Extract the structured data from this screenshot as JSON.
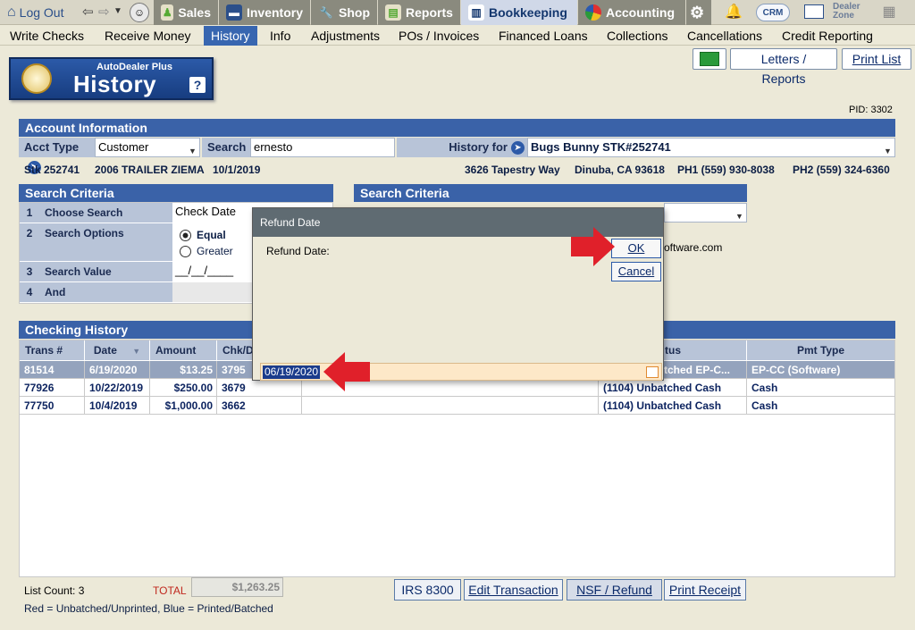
{
  "topnav": {
    "logout": "Log Out",
    "tabs": [
      {
        "label": "Sales",
        "icon": "salesperson-icon"
      },
      {
        "label": "Inventory",
        "icon": "car-icon"
      },
      {
        "label": "Shop",
        "icon": "wrench-icon"
      },
      {
        "label": "Reports",
        "icon": "report-icon"
      },
      {
        "label": "Bookkeeping",
        "icon": "book-icon"
      },
      {
        "label": "Accounting",
        "icon": "pie-chart-icon"
      }
    ],
    "crm_label": "CRM",
    "dealer_zone_label": "Dealer Zone"
  },
  "subnav": [
    "Write Checks",
    "Receive Money",
    "History",
    "Info",
    "Adjustments",
    "POs / Invoices",
    "Financed Loans",
    "Collections",
    "Cancellations",
    "Credit Reporting"
  ],
  "toolbar": {
    "letters": "Letters / Reports",
    "print_list": "Print List"
  },
  "logo": {
    "sub": "AutoDealer Plus",
    "title": "History",
    "help": "?"
  },
  "pid": "PID: 3302",
  "account": {
    "header": "Account Information",
    "acct_type_label": "Acct Type",
    "acct_type_value": "Customer",
    "search_label": "Search",
    "search_value": "ernesto",
    "history_for_label": "History for",
    "history_for_value": "Bugs Bunny STK#252741",
    "stk": "Stk 252741",
    "vehicle": "2006 TRAILER ZIEMA",
    "date": "10/1/2019",
    "address": "3626 Tapestry Way",
    "city": "Dinuba, CA 93618",
    "ph1": "PH1 (559) 930-8038",
    "ph2": "PH2 (559) 324-6360"
  },
  "search_criteria": {
    "header": "Search Criteria",
    "rows": [
      {
        "num": "1",
        "label": "Choose Search",
        "value": "Check Date"
      },
      {
        "num": "2",
        "label": "Search Options",
        "opt1": "Equal",
        "opt2": "Greater"
      },
      {
        "num": "3",
        "label": "Search Value",
        "value": "__/__/____"
      },
      {
        "num": "4",
        "label": "And"
      }
    ],
    "header2": "Search Criteria",
    "partial_email": "oftware.com"
  },
  "history": {
    "header": "Checking History",
    "columns": [
      "Trans #",
      "Date",
      "Amount",
      "Chk/D",
      "tus",
      "Pmt Type"
    ],
    "rows": [
      {
        "trans": "81514",
        "date": "6/19/2020",
        "amount": "$13.25",
        "chk": "3795",
        "status": "tched EP-C...",
        "pmt": "EP-CC (Software)"
      },
      {
        "trans": "77926",
        "date": "10/22/2019",
        "amount": "$250.00",
        "chk": "3679",
        "status": "(1104) Unbatched Cash",
        "pmt": "Cash"
      },
      {
        "trans": "77750",
        "date": "10/4/2019",
        "amount": "$1,000.00",
        "chk": "3662",
        "status": "(1104) Unbatched Cash",
        "pmt": "Cash"
      }
    ]
  },
  "dialog": {
    "title": "Refund Date",
    "label": "Refund Date:",
    "ok": "OK",
    "cancel": "Cancel",
    "date_value": "06/19/2020"
  },
  "footer": {
    "list_count": "List Count: 3",
    "total_label": "TOTAL",
    "total_value": "$1,263.25",
    "legend": "Red = Unbatched/Unprinted, Blue = Printed/Batched",
    "buttons": [
      "IRS 8300",
      "Edit Transaction",
      "NSF / Refund",
      "Print Receipt"
    ]
  },
  "colors": {
    "accent": "#3a62a8",
    "highlight_arrow": "#e0202a",
    "selected_row": "#94a3bd"
  }
}
